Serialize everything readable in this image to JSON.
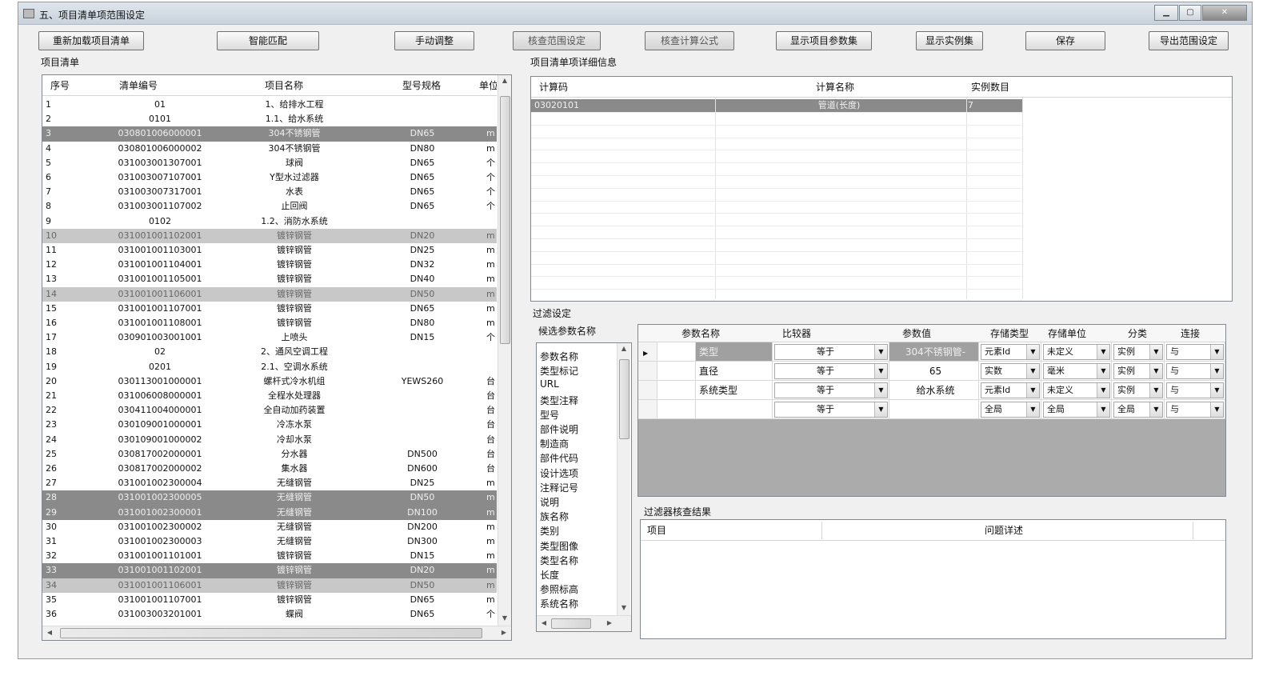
{
  "window": {
    "title": "五、项目清单项范围设定"
  },
  "toolbar": {
    "reload": "重新加载项目清单",
    "smart_match": "智能匹配",
    "manual_adjust": "手动调整",
    "check_range": "核查范围设定",
    "check_formula": "核查计算公式",
    "show_params": "显示项目参数集",
    "show_instances": "显示实例集",
    "save": "保存",
    "export": "导出范围设定"
  },
  "left": {
    "label": "项目清单",
    "columns": [
      "序号",
      "清单编号",
      "项目名称",
      "型号规格",
      "单位"
    ],
    "rows": [
      [
        "1",
        "01",
        "1、给排水工程",
        "",
        ""
      ],
      [
        "2",
        "0101",
        "1.1、给水系统",
        "",
        ""
      ],
      [
        "3",
        "030801006000001",
        "304不锈钢管",
        "DN65",
        "m"
      ],
      [
        "4",
        "030801006000002",
        "304不锈钢管",
        "DN80",
        "m"
      ],
      [
        "5",
        "031003001307001",
        "球阀",
        "DN65",
        "个"
      ],
      [
        "6",
        "031003007107001",
        "Y型水过滤器",
        "DN65",
        "个"
      ],
      [
        "7",
        "031003007317001",
        "水表",
        "DN65",
        "个"
      ],
      [
        "8",
        "031003001107002",
        "止回阀",
        "DN65",
        "个"
      ],
      [
        "9",
        "0102",
        "1.2、消防水系统",
        "",
        ""
      ],
      [
        "10",
        "031001001102001",
        "镀锌钢管",
        "DN20",
        "m"
      ],
      [
        "11",
        "031001001103001",
        "镀锌钢管",
        "DN25",
        "m"
      ],
      [
        "12",
        "031001001104001",
        "镀锌钢管",
        "DN32",
        "m"
      ],
      [
        "13",
        "031001001105001",
        "镀锌钢管",
        "DN40",
        "m"
      ],
      [
        "14",
        "031001001106001",
        "镀锌钢管",
        "DN50",
        "m"
      ],
      [
        "15",
        "031001001107001",
        "镀锌钢管",
        "DN65",
        "m"
      ],
      [
        "16",
        "031001001108001",
        "镀锌钢管",
        "DN80",
        "m"
      ],
      [
        "17",
        "030901003001001",
        "上喷头",
        "DN15",
        "个"
      ],
      [
        "18",
        "02",
        "2、通风空调工程",
        "",
        ""
      ],
      [
        "19",
        "0201",
        "2.1、空调水系统",
        "",
        ""
      ],
      [
        "20",
        "030113001000001",
        "螺杆式冷水机组",
        "YEWS260",
        "台"
      ],
      [
        "21",
        "031006008000001",
        "全程水处理器",
        "",
        "台"
      ],
      [
        "22",
        "030411004000001",
        "全自动加药装置",
        "",
        "台"
      ],
      [
        "23",
        "030109001000001",
        "冷冻水泵",
        "",
        "台"
      ],
      [
        "24",
        "030109001000002",
        "冷却水泵",
        "",
        "台"
      ],
      [
        "25",
        "030817002000001",
        "分水器",
        "DN500",
        "台"
      ],
      [
        "26",
        "030817002000002",
        "集水器",
        "DN600",
        "台"
      ],
      [
        "27",
        "031001002300004",
        "无缝钢管",
        "DN25",
        "m"
      ],
      [
        "28",
        "031001002300005",
        "无缝钢管",
        "DN50",
        "m"
      ],
      [
        "29",
        "031001002300001",
        "无缝钢管",
        "DN100",
        "m"
      ],
      [
        "30",
        "031001002300002",
        "无缝钢管",
        "DN200",
        "m"
      ],
      [
        "31",
        "031001002300003",
        "无缝钢管",
        "DN300",
        "m"
      ],
      [
        "32",
        "031001001101001",
        "镀锌钢管",
        "DN15",
        "m"
      ],
      [
        "33",
        "031001001102001",
        "镀锌钢管",
        "DN20",
        "m"
      ],
      [
        "34",
        "031001001106001",
        "镀锌钢管",
        "DN50",
        "m"
      ],
      [
        "35",
        "031001001107001",
        "镀锌钢管",
        "DN65",
        "m"
      ],
      [
        "36",
        "031003003201001",
        "蝶阀",
        "DN65",
        "个"
      ]
    ]
  },
  "detail": {
    "label": "项目清单项详细信息",
    "columns": [
      "计算码",
      "计算名称",
      "实例数目"
    ],
    "rows": [
      [
        "03020101",
        "管道(长度)",
        "7"
      ]
    ]
  },
  "filter": {
    "label": "过滤设定",
    "candidates_label": "候选参数名称",
    "candidates": [
      "参数名称",
      "类型标记",
      "URL",
      "类型注释",
      "型号",
      "部件说明",
      "制造商",
      "部件代码",
      "设计选项",
      "注释记号",
      "说明",
      "族名称",
      "类别",
      "类型图像",
      "类型名称",
      "长度",
      "参照标高",
      "系统名称"
    ],
    "columns": [
      "参数名称",
      "比较器",
      "参数值",
      "存储类型",
      "存储单位",
      "分类",
      "连接"
    ],
    "rows": [
      [
        "类型",
        "等于",
        "304不锈钢管-",
        "元素Id",
        "未定义",
        "实例",
        "与"
      ],
      [
        "直径",
        "等于",
        "65",
        "实数",
        "毫米",
        "实例",
        "与"
      ],
      [
        "系统类型",
        "等于",
        "给水系统",
        "元素Id",
        "未定义",
        "实例",
        "与"
      ],
      [
        "",
        "等于",
        "",
        "全局",
        "全局",
        "全局",
        "与"
      ]
    ]
  },
  "result": {
    "label": "过滤器核查结果",
    "columns": [
      "项目",
      "问题详述"
    ]
  }
}
